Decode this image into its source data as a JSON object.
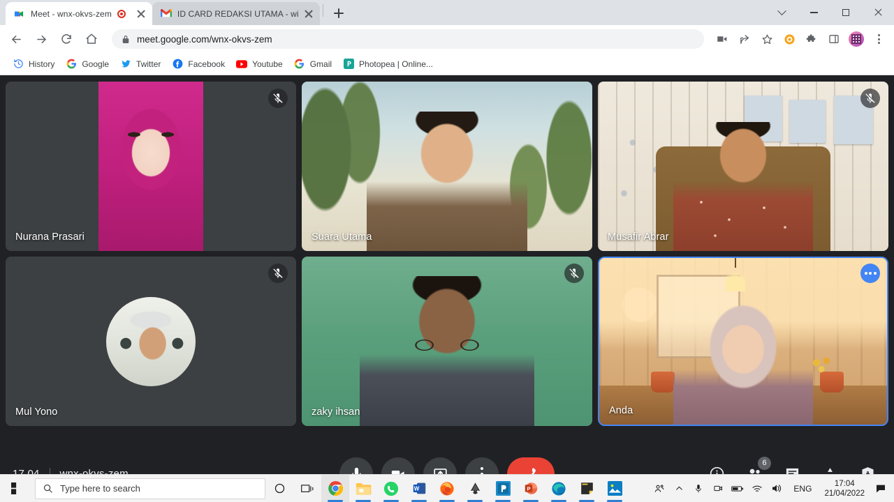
{
  "browser": {
    "tabs": [
      {
        "title": "Meet - wnx-okvs-zem",
        "favicon": "google-meet-icon",
        "recording": true,
        "active": true
      },
      {
        "title": "ID CARD REDAKSI UTAMA - widh",
        "favicon": "gmail-icon",
        "recording": false,
        "active": false
      }
    ],
    "new_tab_label": "+",
    "window_controls": {
      "minimize": "–",
      "maximize": "□",
      "close": "×",
      "chevron": "⌄"
    },
    "address": "meet.google.com/wnx-okvs-zem",
    "toolbar_icons": [
      "camera-icon",
      "share-icon",
      "bookmark-star-icon",
      "orange-circle-extension-icon",
      "puzzle-extension-icon",
      "sidepanel-icon",
      "profile-avatar-icon",
      "chrome-menu-icon"
    ],
    "bookmarks": [
      {
        "label": "History",
        "icon": "history-icon"
      },
      {
        "label": "Google",
        "icon": "google-icon"
      },
      {
        "label": "Twitter",
        "icon": "twitter-icon"
      },
      {
        "label": "Facebook",
        "icon": "facebook-icon"
      },
      {
        "label": "Youtube",
        "icon": "youtube-icon"
      },
      {
        "label": "Gmail",
        "icon": "google-icon"
      },
      {
        "label": "Photopea | Online...",
        "icon": "photopea-icon"
      }
    ]
  },
  "meet": {
    "participants": [
      {
        "name": "Nurana Prasari",
        "muted": true,
        "kind": "video-portrait",
        "selected": false
      },
      {
        "name": "Suara Utama",
        "muted": false,
        "kind": "video",
        "selected": false
      },
      {
        "name": "Musafir Abrar",
        "muted": true,
        "kind": "video",
        "selected": false
      },
      {
        "name": "Mul Yono",
        "muted": true,
        "kind": "avatar",
        "selected": false
      },
      {
        "name": "zaky ihsan",
        "muted": true,
        "kind": "video",
        "selected": false
      },
      {
        "name": "Anda",
        "muted": false,
        "kind": "video",
        "selected": true,
        "more_options": true
      }
    ],
    "bottom_bar": {
      "time": "17.04",
      "meeting_code": "wnx-okvs-zem",
      "controls": [
        {
          "name": "microphone-button",
          "icon": "microphone-icon"
        },
        {
          "name": "camera-button",
          "icon": "video-camera-icon"
        },
        {
          "name": "present-screen-button",
          "icon": "present-screen-icon"
        },
        {
          "name": "more-options-button",
          "icon": "kebab-menu-icon"
        },
        {
          "name": "leave-call-button",
          "icon": "hangup-phone-icon"
        }
      ],
      "right_controls": [
        {
          "name": "meeting-details-button",
          "icon": "info-icon",
          "badge": null
        },
        {
          "name": "show-everyone-button",
          "icon": "people-icon",
          "badge": "6"
        },
        {
          "name": "chat-button",
          "icon": "chat-icon",
          "badge": null
        },
        {
          "name": "activities-button",
          "icon": "activities-icon",
          "badge": null
        },
        {
          "name": "host-controls-button",
          "icon": "shield-lock-icon",
          "badge": null
        }
      ]
    },
    "accent_color": "#4285f4",
    "hangup_color": "#ea4335"
  },
  "taskbar": {
    "search_placeholder": "Type here to search",
    "apps": [
      {
        "name": "cortana-icon"
      },
      {
        "name": "task-view-icon"
      },
      {
        "name": "chrome-icon"
      },
      {
        "name": "file-explorer-icon"
      },
      {
        "name": "whatsapp-icon"
      },
      {
        "name": "word-icon"
      },
      {
        "name": "firefox-icon"
      },
      {
        "name": "inkscape-icon"
      },
      {
        "name": "photopea-icon"
      },
      {
        "name": "powerpoint-icon"
      },
      {
        "name": "edge-icon"
      },
      {
        "name": "sticky-notes-icon"
      },
      {
        "name": "photos-icon"
      }
    ],
    "tray": {
      "language": "ENG",
      "time": "17:04",
      "date": "21/04/2022",
      "icons": [
        "meet-now-people-icon",
        "show-hidden-icons-chevron",
        "microphone-icon",
        "camera-icon",
        "battery-icon",
        "wifi-icon",
        "volume-icon",
        "notifications-icon"
      ]
    }
  }
}
